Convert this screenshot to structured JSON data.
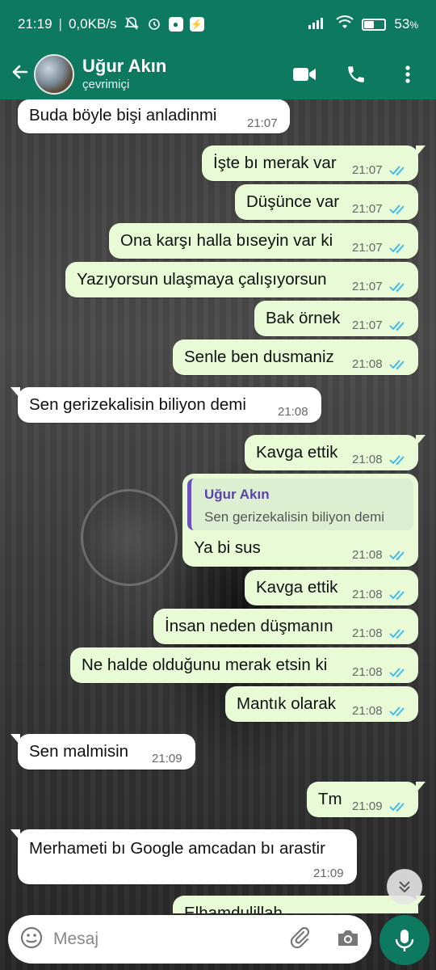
{
  "status_bar": {
    "time": "21:19",
    "net_speed": "0,0KB/s",
    "battery": "53",
    "battery_level": 0.53
  },
  "header": {
    "contact_name": "Uğur Akın",
    "presence": "çevrimiçi",
    "icons": [
      "back-arrow-icon",
      "video-call-icon",
      "phone-icon",
      "more-vert-icon"
    ]
  },
  "messages": [
    {
      "dir": "in",
      "text": "Buda böyle bişi anladinmi",
      "time": "21:07"
    },
    {
      "dir": "out",
      "text": "İşte bı merak var",
      "time": "21:07"
    },
    {
      "dir": "out",
      "text": "Düşünce var",
      "time": "21:07"
    },
    {
      "dir": "out",
      "text": "Ona karşı halla bıseyin var ki",
      "time": "21:07"
    },
    {
      "dir": "out",
      "text": "Yazıyorsun ulaşmaya çalışıyorsun",
      "time": "21:07"
    },
    {
      "dir": "out",
      "text": "Bak örnek",
      "time": "21:07"
    },
    {
      "dir": "out",
      "text": "Senle ben dusmaniz",
      "time": "21:08"
    },
    {
      "dir": "in",
      "text": "Sen gerizekalisin biliyon demi",
      "time": "21:08"
    },
    {
      "dir": "out",
      "text": "Kavga ettik",
      "time": "21:08"
    },
    {
      "dir": "out",
      "text": "Ya bi sus",
      "time": "21:08",
      "quote": {
        "name": "Uğur Akın",
        "text": "Sen gerizekalisin biliyon demi"
      }
    },
    {
      "dir": "out",
      "text": "Kavga ettik",
      "time": "21:08"
    },
    {
      "dir": "out",
      "text": "İnsan neden düşmanın",
      "time": "21:08"
    },
    {
      "dir": "out",
      "text": "Ne halde olduğunu merak etsin ki",
      "time": "21:08"
    },
    {
      "dir": "out",
      "text": "Mantık olarak",
      "time": "21:08"
    },
    {
      "dir": "in",
      "text": "Sen malmisin",
      "time": "21:09"
    },
    {
      "dir": "out",
      "text": "Tm",
      "time": "21:09"
    },
    {
      "dir": "in",
      "text": "Merhameti bı Google amcadan bı arastir",
      "time": "21:09"
    },
    {
      "dir": "out",
      "text": "Elhamdulillah",
      "time": ""
    }
  ],
  "composer": {
    "placeholder": "Mesaj",
    "icons": [
      "emoji-icon",
      "attach-icon",
      "camera-icon",
      "mic-icon"
    ]
  },
  "colors": {
    "header": "#0d7a5f",
    "outgoing_bubble": "#e8fbd6",
    "incoming_bubble": "#ffffff",
    "read_ticks": "#34b7f1",
    "quote_accent": "#6b4fbb"
  }
}
